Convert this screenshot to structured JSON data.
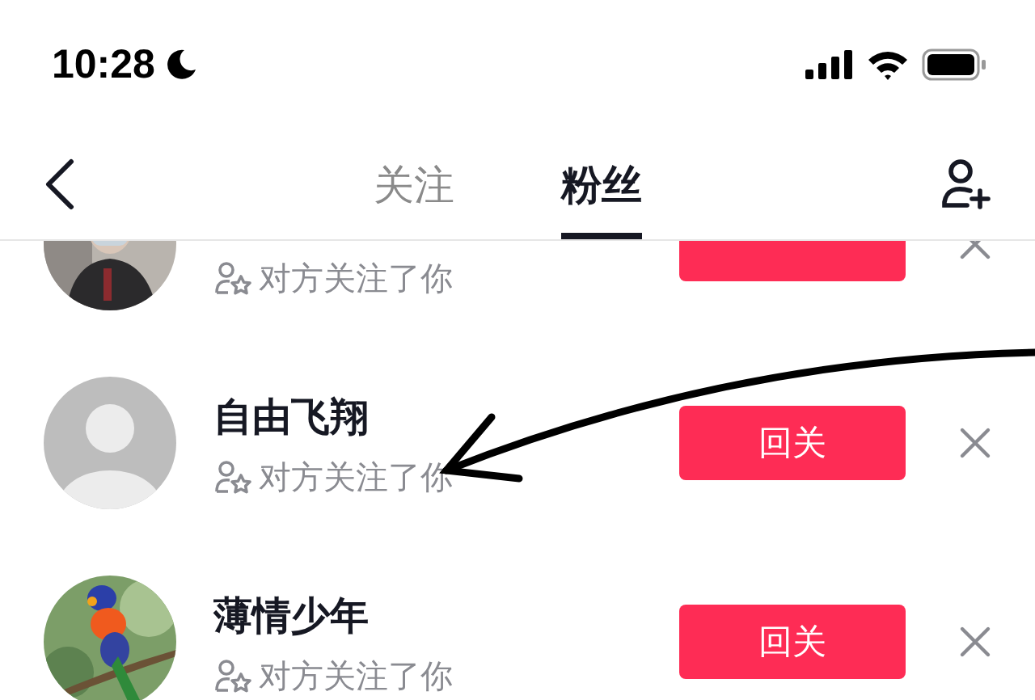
{
  "status_bar": {
    "time": "10:28"
  },
  "header": {
    "tabs": [
      {
        "label": "关注",
        "selected": false
      },
      {
        "label": "粉丝",
        "selected": true
      }
    ]
  },
  "followers": [
    {
      "subtitle": "对方关注了你"
    },
    {
      "kind": "default",
      "name": "自由飞翔",
      "subtitle": "对方关注了你",
      "button_label": "回关"
    },
    {
      "name": "薄情少年",
      "subtitle": "对方关注了你",
      "button_label": "回关"
    }
  ]
}
